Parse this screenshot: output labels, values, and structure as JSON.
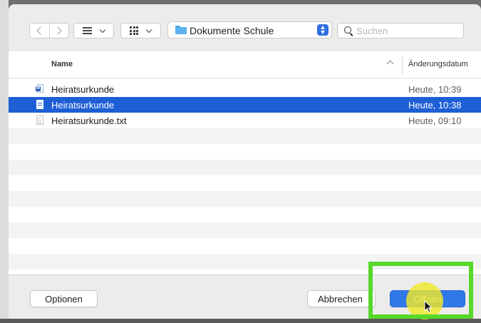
{
  "toolbar": {
    "location": "Dokumente Schule",
    "search_placeholder": "Suchen"
  },
  "columns": {
    "name": "Name",
    "date": "Änderungsdatum"
  },
  "files": [
    {
      "name": "Heiratsurkunde",
      "date": "Heute, 10:39",
      "icon": "word-document-icon",
      "selected": false
    },
    {
      "name": "Heiratsurkunde",
      "date": "Heute, 10:38",
      "icon": "pages-document-icon",
      "selected": true
    },
    {
      "name": "Heiratsurkunde.txt",
      "date": "Heute, 09:10",
      "icon": "text-document-icon",
      "selected": false
    }
  ],
  "buttons": {
    "options": "Optionen",
    "cancel": "Abbrechen",
    "open": "Öffnen"
  },
  "colors": {
    "selection": "#1e5fd6",
    "primary_button": "#2f78e8",
    "highlight_box": "#58d82a",
    "cursor_halo": "#f0e828"
  }
}
